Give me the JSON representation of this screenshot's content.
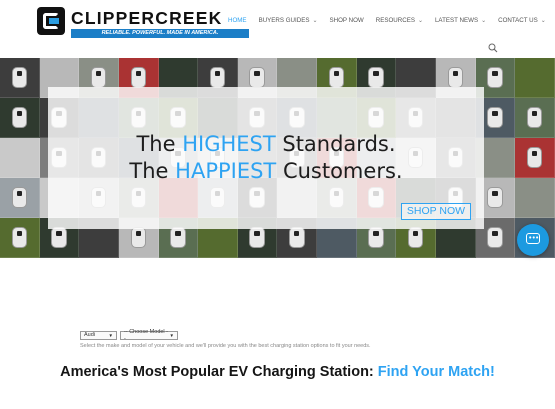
{
  "header": {
    "logo_name": "CLIPPERCREEK",
    "logo_tagline": "RELIABLE. POWERFUL. MADE IN AMERICA.",
    "nav": [
      {
        "label": "HOME",
        "active": true,
        "dropdown": false
      },
      {
        "label": "BUYERS GUIDES",
        "active": false,
        "dropdown": true
      },
      {
        "label": "SHOP NOW",
        "active": false,
        "dropdown": false
      },
      {
        "label": "RESOURCES",
        "active": false,
        "dropdown": true
      },
      {
        "label": "LATEST NEWS",
        "active": false,
        "dropdown": true
      },
      {
        "label": "CONTACT US",
        "active": false,
        "dropdown": true
      }
    ],
    "search_icon": "search-icon"
  },
  "hero": {
    "line1_prefix": "The ",
    "line1_highlight": "HIGHEST",
    "line1_suffix": " Standards.",
    "line2_prefix": "The ",
    "line2_highlight": "HAPPIEST",
    "line2_suffix": " Customers.",
    "cta_label": "SHOP NOW",
    "chat_icon": "chat-icon"
  },
  "finder": {
    "make_value": "Audi",
    "model_value": "-- Choose Model --",
    "helper_text": "Select the make and model of your vehicle and we'll provide you with the best charging station options to fit your needs.",
    "headline_prefix": "America's Most Popular EV Charging Station: ",
    "headline_highlight": "Find Your Match!"
  },
  "colors": {
    "accent": "#2ea3f2",
    "brand_blue": "#1b7ec7",
    "text": "#1d1d1d"
  }
}
